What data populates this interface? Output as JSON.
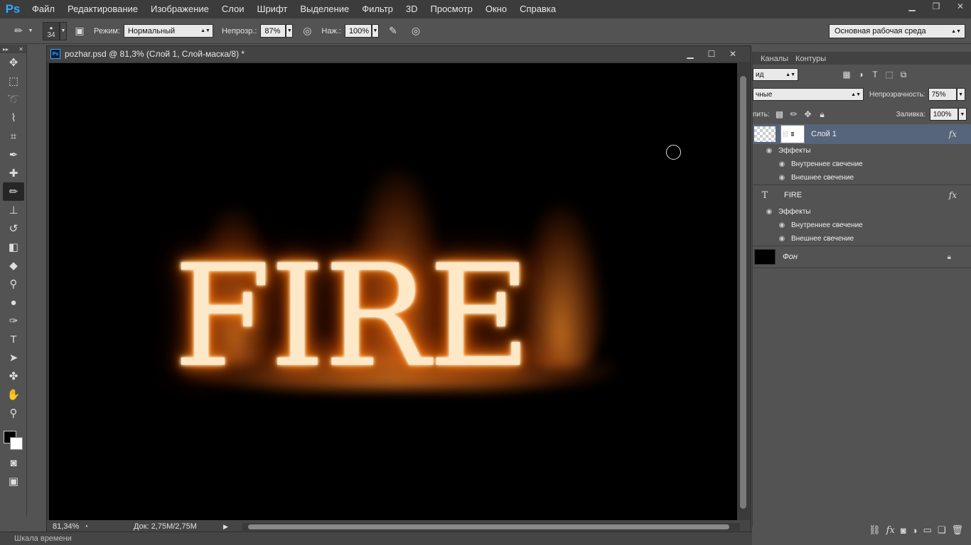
{
  "app": {
    "logo": "Ps"
  },
  "menu": [
    "Файл",
    "Редактирование",
    "Изображение",
    "Слои",
    "Шрифт",
    "Выделение",
    "Фильтр",
    "3D",
    "Просмотр",
    "Окно",
    "Справка"
  ],
  "options": {
    "brush_size": "34",
    "mode_label": "Режим:",
    "mode_value": "Нормальный",
    "opacity_label": "Непрозр.:",
    "opacity_value": "87%",
    "pressure_label": "Наж.:",
    "pressure_value": "100%",
    "workspace": "Основная рабочая среда"
  },
  "document": {
    "title": "pozhar.psd @ 81,3% (Слой 1, Слой-маска/8) *",
    "canvas_text": "FIRE",
    "zoom": "81,34%",
    "doc_info": "Док: 2,75M/2,75M"
  },
  "layers_panel": {
    "tabs": [
      "Каналы",
      "Контуры"
    ],
    "filter_value": "ид",
    "blend_value": "чные",
    "opacity_label": "Непрозрачность:",
    "opacity_value": "75%",
    "lock_label": "пить:",
    "fill_label": "Заливка:",
    "fill_value": "100%",
    "layers": [
      {
        "name": "Слой 1",
        "fx": "fx",
        "effects_label": "Эффекты",
        "effects": [
          "Внутреннее свечение",
          "Внешнее свечение"
        ]
      },
      {
        "name": "FIRE",
        "fx": "fx",
        "effects_label": "Эффекты",
        "effects": [
          "Внутреннее свечение",
          "Внешнее свечение"
        ]
      },
      {
        "name": "Фон"
      }
    ]
  },
  "timeline": {
    "label": "Шкала времени"
  },
  "colors": {
    "selection": "#56657a",
    "accent": "#31a8ff"
  }
}
